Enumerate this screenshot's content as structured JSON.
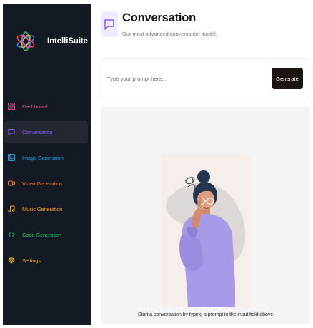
{
  "app": {
    "name": "IntelliSuite"
  },
  "sidebar": {
    "items": [
      {
        "label": "Dashboard",
        "icon": "dashboard-icon",
        "color": "#e0457b",
        "active": false
      },
      {
        "label": "Conversation",
        "icon": "message-square-icon",
        "color": "#8b5cf6",
        "active": true
      },
      {
        "label": "Image Generation",
        "icon": "image-icon",
        "color": "#0ea5e9",
        "active": false
      },
      {
        "label": "Video Generation",
        "icon": "video-icon",
        "color": "#f97316",
        "active": false
      },
      {
        "label": "Music Generation",
        "icon": "music-icon",
        "color": "#f59e0b",
        "active": false
      },
      {
        "label": "Code Generation",
        "icon": "code-icon",
        "color": "#22c55e",
        "active": false
      },
      {
        "label": "Settings",
        "icon": "gear-icon",
        "color": "#eab308",
        "active": false
      }
    ]
  },
  "header": {
    "title": "Conversation",
    "subtitle": "Our most advanced conversation model.",
    "icon": "message-square-icon",
    "accent_color": "#8b5cf6"
  },
  "prompt": {
    "placeholder": "Type your prompt here...",
    "value": "",
    "button_label": "Generate"
  },
  "empty_state": {
    "caption": "Start a conversation by typing a prompt in the input field above"
  }
}
